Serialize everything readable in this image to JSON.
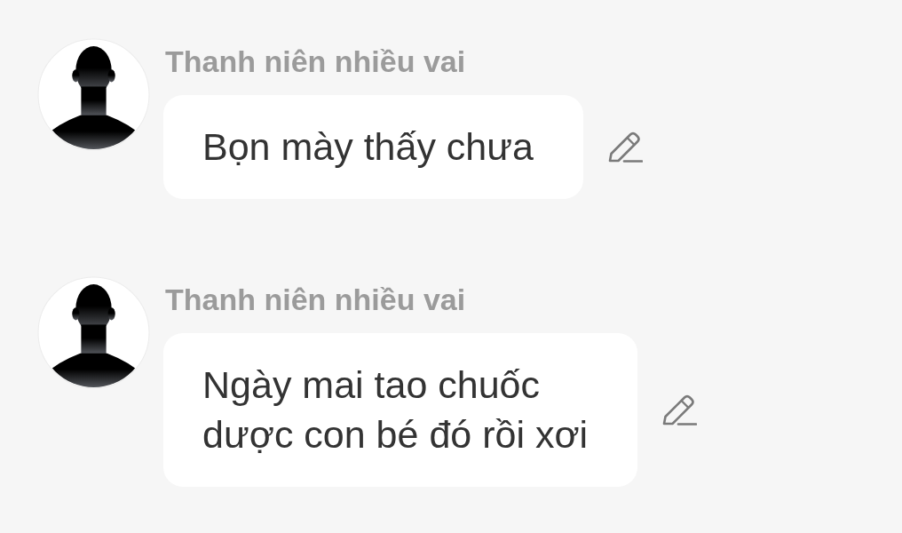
{
  "messages": [
    {
      "author": "Thanh niên nhiều vai",
      "text": "Bọn mày thấy chưa"
    },
    {
      "author": "Thanh niên nhiều vai",
      "text": "Ngày mai tao chuốc\ndược con bé đó rồi xơi"
    }
  ]
}
